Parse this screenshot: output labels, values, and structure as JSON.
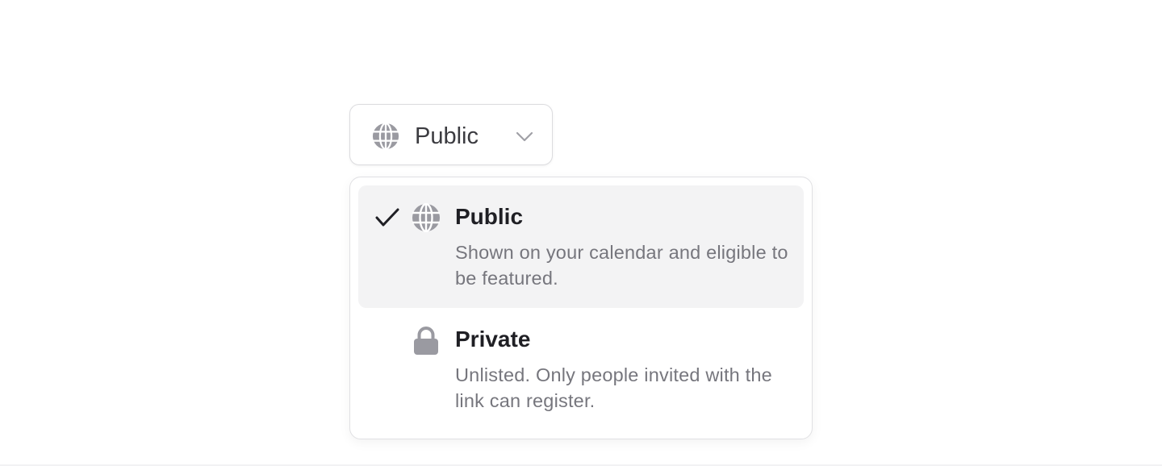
{
  "visibility_select": {
    "selected_label": "Public",
    "selected_icon": "globe-icon",
    "toggle_icon": "chevron-down-icon"
  },
  "menu": {
    "options": [
      {
        "label": "Public",
        "description": "Shown on your calendar and eligible to be featured.",
        "icon": "globe-icon",
        "selected": true
      },
      {
        "label": "Private",
        "description": "Unlisted. Only people invited with the link can register.",
        "icon": "lock-icon",
        "selected": false
      }
    ]
  },
  "colors": {
    "icon_gray": "#9a9aa1",
    "highlight_bg": "#f3f3f4",
    "text_primary": "#1f1f24",
    "text_secondary": "#76767d",
    "border": "#dcdcdf"
  }
}
